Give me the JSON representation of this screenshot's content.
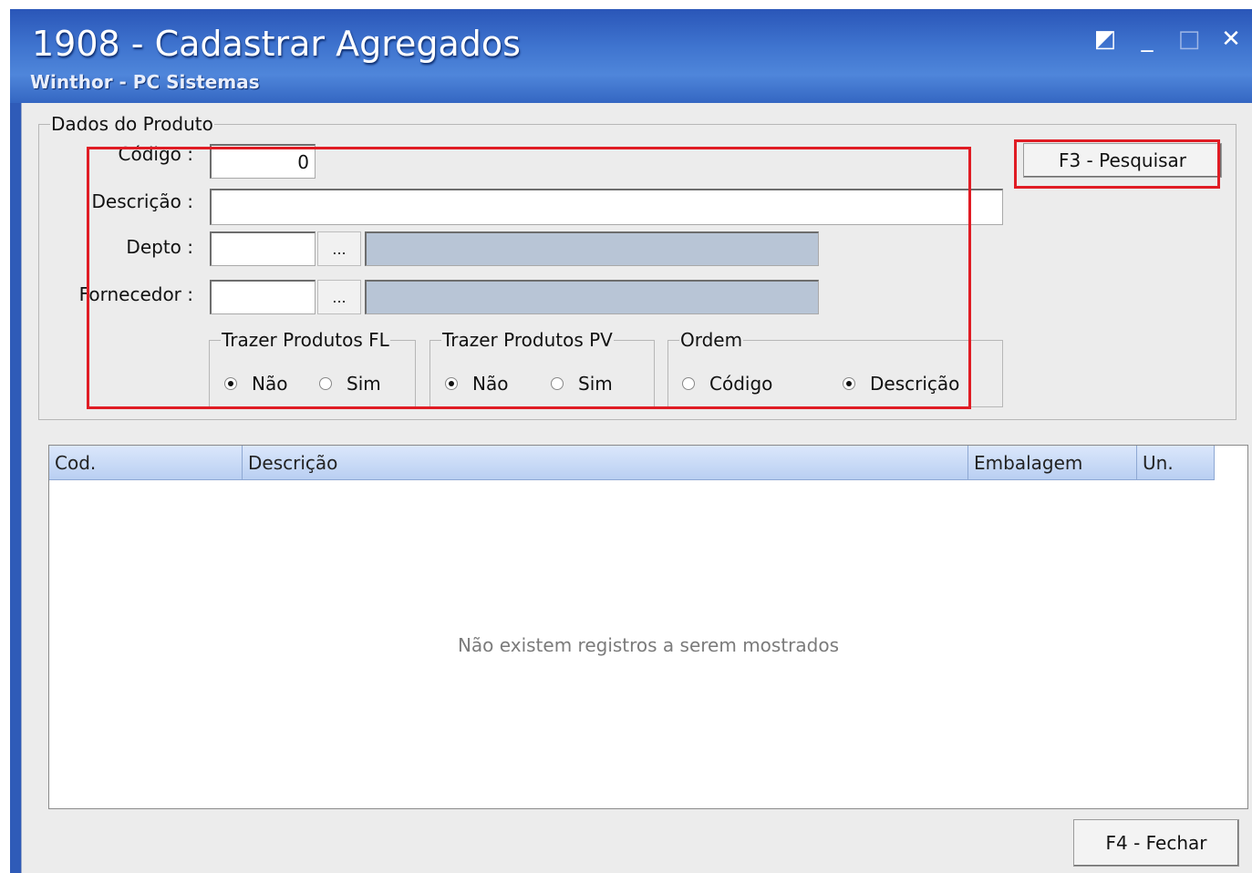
{
  "window": {
    "title": "1908 - Cadastrar Agregados",
    "subtitle": "Winthor - PC Sistemas",
    "controls": {
      "help": "◩",
      "minimize": "_",
      "maximize": "□",
      "close": "✕"
    }
  },
  "produto": {
    "legend": "Dados do Produto",
    "codigo_label": "Código :",
    "codigo_value": "0",
    "descricao_label": "Descrição :",
    "descricao_value": "",
    "depto_label": "Depto :",
    "depto_value": "",
    "depto_desc": "",
    "fornecedor_label": "Fornecedor :",
    "fornecedor_value": "",
    "fornecedor_desc": "",
    "ellipsis": "...",
    "fl": {
      "legend": "Trazer Produtos FL",
      "nao": "Não",
      "sim": "Sim",
      "selected": "Não"
    },
    "pv": {
      "legend": "Trazer Produtos PV",
      "nao": "Não",
      "sim": "Sim",
      "selected": "Não"
    },
    "ordem": {
      "legend": "Ordem",
      "codigo": "Código",
      "descricao": "Descrição",
      "selected": "Descrição"
    }
  },
  "buttons": {
    "pesquisar": "F3 - Pesquisar",
    "fechar": "F4 - Fechar"
  },
  "grid": {
    "columns": [
      "Cod.",
      "Descrição",
      "Embalagem",
      "Un."
    ],
    "empty_message": "Não existem registros a serem mostrados"
  },
  "colors": {
    "highlight": "#e01c24",
    "title_bar": "#3f74cf",
    "readonly_field": "#b8c5d6"
  },
  "icons": [
    "help-icon",
    "minimize-icon",
    "maximize-icon",
    "close-icon"
  ]
}
